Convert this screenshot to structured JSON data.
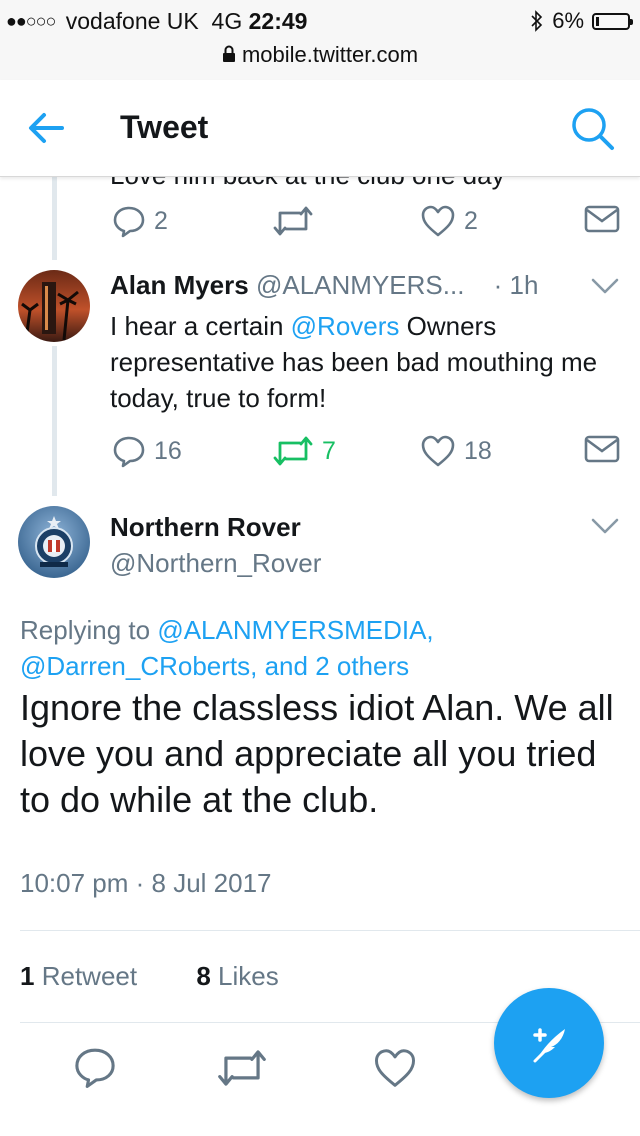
{
  "status_bar": {
    "signal": "●●○○○",
    "carrier": "vodafone UK",
    "network": "4G",
    "time": "22:49",
    "battery": "6%",
    "url": "mobile.twitter.com"
  },
  "nav": {
    "title": "Tweet"
  },
  "previous_tweet": {
    "partial_text": "Love him back at the club one day",
    "reply_count": "2",
    "like_count": "2"
  },
  "reply_tweet": {
    "name": "Alan Myers",
    "handle": "@ALANMYERS...",
    "time": "· 1h",
    "text_before": "I hear a certain ",
    "mention": "@Rovers",
    "text_after": " Owners representative has been bad mouthing me today, true to form!",
    "reply_count": "16",
    "retweet_count": "7",
    "like_count": "18"
  },
  "main_tweet": {
    "name": "Northern Rover",
    "handle": "@Northern_Rover",
    "replying_label": "Replying to ",
    "replying_mention1": "@ALANMYERSMEDIA,",
    "replying_rest": "@Darren_CRoberts, and 2 others",
    "text": "Ignore the classless idiot Alan. We all love you and appreciate all you tried to do while at the club.",
    "timestamp": "10:07 pm · 8 Jul 2017",
    "retweets_count": "1",
    "retweets_label": "Retweet",
    "likes_count": "8",
    "likes_label": "Likes"
  },
  "colors": {
    "accent": "#1da1f2",
    "retweet_green": "#17bf63",
    "muted": "#657786"
  }
}
